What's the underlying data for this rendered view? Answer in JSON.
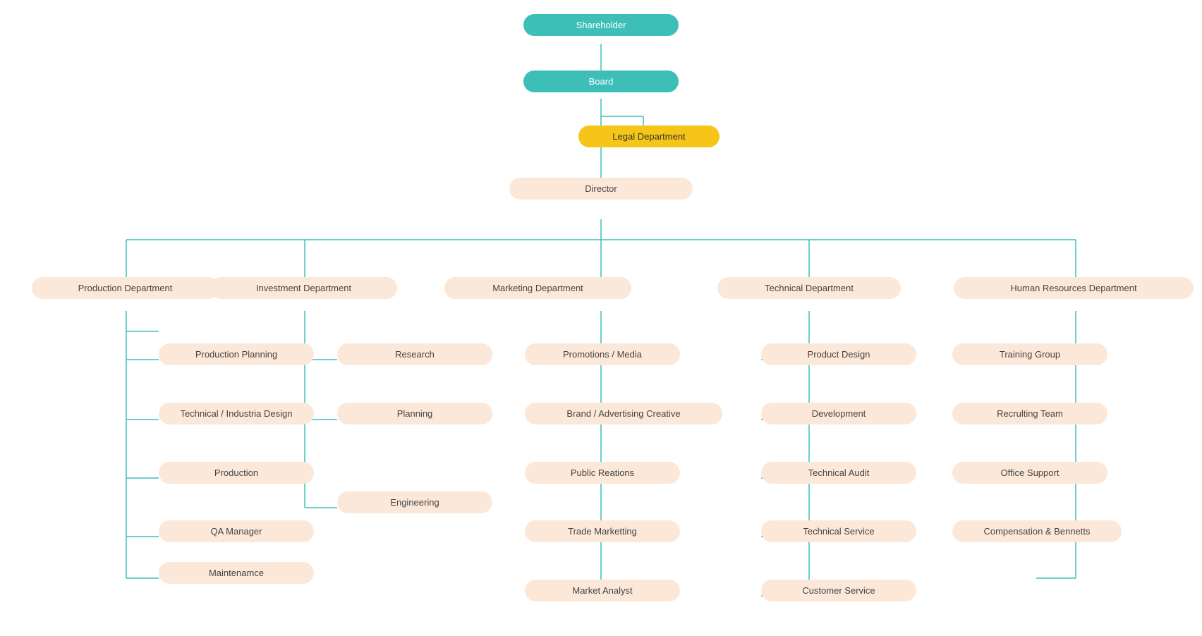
{
  "nodes": {
    "shareholder": {
      "label": "Shareholder"
    },
    "board": {
      "label": "Board"
    },
    "legal": {
      "label": "Legal  Department"
    },
    "director": {
      "label": "Director"
    },
    "prod_dept": {
      "label": "Production Department"
    },
    "invest_dept": {
      "label": "Investment Department"
    },
    "mkt_dept": {
      "label": "Marketing Department"
    },
    "tech_dept": {
      "label": "Technical Department"
    },
    "hr_dept": {
      "label": "Human Resources Department"
    },
    "prod_planning": {
      "label": "Production Planning"
    },
    "tech_ind_design": {
      "label": "Technical / Industria Design"
    },
    "production": {
      "label": "Production"
    },
    "qa_manager": {
      "label": "QA Manager"
    },
    "maintenance": {
      "label": "Maintenamce"
    },
    "research": {
      "label": "Research"
    },
    "planning": {
      "label": "Planning"
    },
    "engineering": {
      "label": "Engineering"
    },
    "promotions_media": {
      "label": "Promotions / Media"
    },
    "brand_adv": {
      "label": "Brand / Advertising Creative"
    },
    "public_relations": {
      "label": "Public Reations"
    },
    "trade_marketing": {
      "label": "Trade Marketting"
    },
    "market_analyst": {
      "label": "Market Analyst"
    },
    "product_design": {
      "label": "Product Design"
    },
    "development": {
      "label": "Development"
    },
    "tech_audit": {
      "label": "Technical Audit"
    },
    "tech_service": {
      "label": "Technical Service"
    },
    "customer_service": {
      "label": "Customer Service"
    },
    "training_group": {
      "label": "Training Group"
    },
    "recruiting_team": {
      "label": "Recrulting Team"
    },
    "office_support": {
      "label": "Office Support"
    },
    "compensation": {
      "label": "Compensation & Bennetts"
    }
  },
  "colors": {
    "teal": "#3dbfb8",
    "gold": "#f5c518",
    "peach": "#fce8d8",
    "text_light": "#fff",
    "text_dark": "#444",
    "connector": "#3dbfb8"
  }
}
